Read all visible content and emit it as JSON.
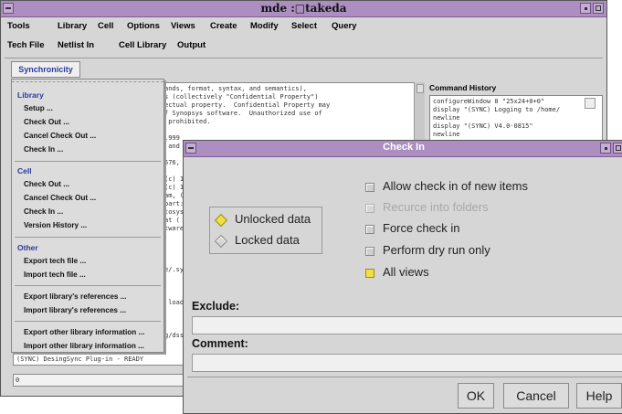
{
  "main_window": {
    "title": "mde :□takeda",
    "menu_row1": [
      "Tools",
      "Library",
      "Cell",
      "Options",
      "Views",
      "Create",
      "Modify",
      "Select",
      "Query"
    ],
    "menu_row2": [
      "Tech File",
      "Netlist In",
      "Cell Library",
      "Output"
    ],
    "active_tab": "Synchronicity"
  },
  "dropdown": {
    "sections": [
      {
        "header": "Library",
        "items": [
          "Setup ...",
          "Check Out ...",
          "Cancel Check Out ...",
          "Check In ..."
        ]
      },
      {
        "header": "Cell",
        "items": [
          "Check Out ...",
          "Cancel Check Out ...",
          "Check In ...",
          "Version History ..."
        ]
      },
      {
        "header": "Other",
        "items": [
          "Export tech file ...",
          "Import tech file ...",
          "Export library's references ...",
          "Import library's references ...",
          "Export other library information ...",
          "Import other library information ..."
        ]
      }
    ]
  },
  "console": {
    "lines": [
      "ands, format, syntax, and semantics),",
      "s (collectively \"Confidential Property\")",
      "ectual property.  Confidential Property may",
      "f Synopsys software.  Unauthorized use of",
      " prohibited.",
      "",
      ".999",
      " and",
      "",
      "576,",
      "",
      "(c) 1",
      "(c) 1",
      "am, (",
      "part:",
      "tosys",
      "at (",
      "tware",
      "",
      "",
      "",
      "",
      "e/.sy",
      "",
      "",
      "",
      " load",
      "",
      "",
      "",
      "g/dss"
    ],
    "footer": "(SYNC) DesingSync Plug-in - READY",
    "status": "0"
  },
  "history": {
    "label": "Command History",
    "lines": [
      "configureWindow 0 \"25x24+0+0\"",
      "display \"(SYNC) Logging to /home/",
      "newline",
      "display \"(SYNC) V4.0-0815\"",
      "newline"
    ]
  },
  "dialog": {
    "title": "Check In",
    "radios": [
      {
        "label": "Unlocked data",
        "selected": true
      },
      {
        "label": "Locked data",
        "selected": false
      }
    ],
    "options": [
      {
        "label": "Allow check in of new items",
        "checked": false,
        "enabled": true
      },
      {
        "label": "Recurce into folders",
        "checked": false,
        "enabled": false
      },
      {
        "label": "Force check in",
        "checked": false,
        "enabled": true
      },
      {
        "label": "Perform dry run only",
        "checked": false,
        "enabled": true
      },
      {
        "label": "All views",
        "checked": true,
        "enabled": true
      }
    ],
    "exclude_label": "Exclude:",
    "exclude_value": "",
    "comment_label": "Comment:",
    "comment_value": "",
    "buttons": {
      "ok": "OK",
      "cancel": "Cancel",
      "help": "Help"
    }
  },
  "colors": {
    "title_bar": "#ad8ec0",
    "menu_header": "#2b3a9a",
    "radio_selected": "#f0e040",
    "checkbox_checked": "#f0e040"
  }
}
